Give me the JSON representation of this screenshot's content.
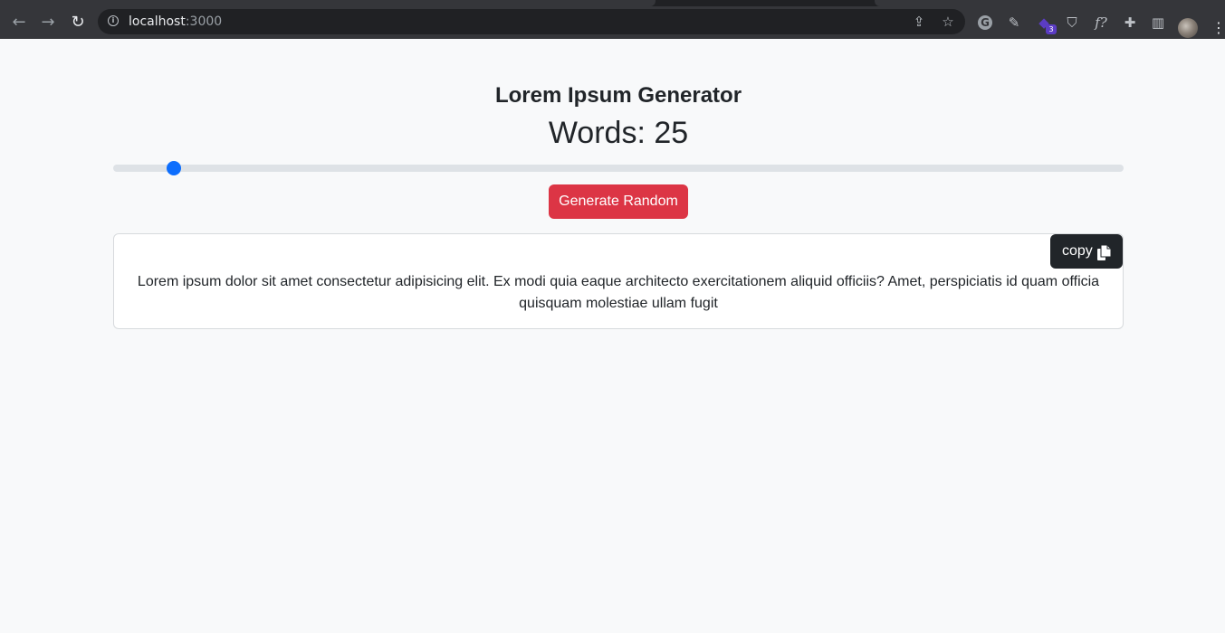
{
  "browser": {
    "url_host": "localhost",
    "url_port": ":3000",
    "extensions": [
      {
        "name": "grammarly-icon",
        "glyph": "G"
      },
      {
        "name": "pen-icon",
        "glyph": "✎"
      },
      {
        "name": "cube-extension-icon",
        "glyph": "◆",
        "badge": "3"
      },
      {
        "name": "shield-extension-icon",
        "glyph": "⛉"
      },
      {
        "name": "formula-icon",
        "glyph": "f?"
      },
      {
        "name": "puzzle-icon",
        "glyph": "✚"
      },
      {
        "name": "side-panel-icon",
        "glyph": "▥"
      }
    ]
  },
  "app": {
    "title": "Lorem Ipsum Generator",
    "words_label": "Words: 25",
    "slider_fraction": 0.054,
    "generate_label": "Generate Random",
    "copy_label": "copy",
    "lorem_text": "Lorem ipsum dolor sit amet consectetur adipisicing elit. Ex modi quia eaque architecto exercitationem aliquid officiis? Amet, perspiciatis id quam officia quisquam molestiae ullam fugit"
  },
  "colors": {
    "accent": "#0d6efd",
    "danger": "#dc3545",
    "dark": "#212529",
    "page_bg": "#f8f9fa"
  }
}
